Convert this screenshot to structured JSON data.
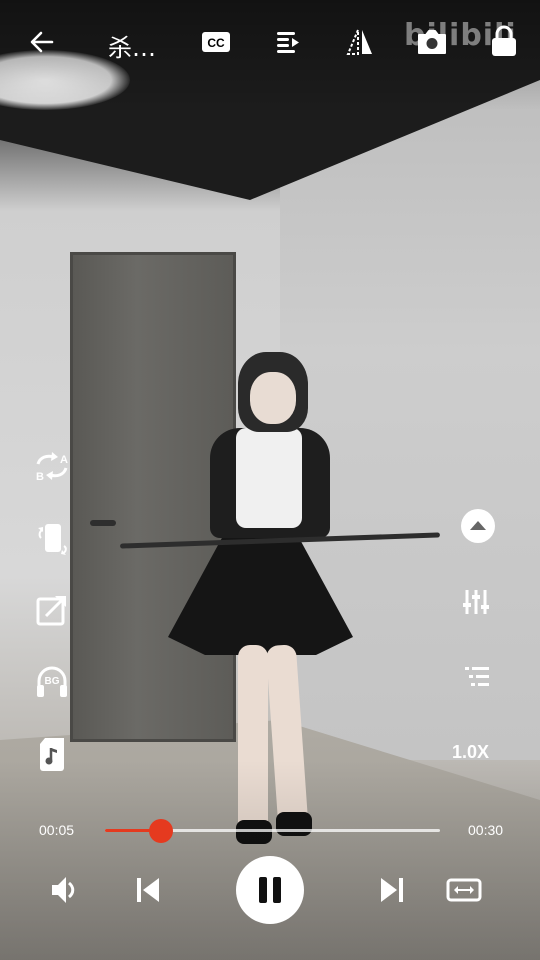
{
  "header": {
    "title": "杀…",
    "watermark": "bilibili"
  },
  "toolbar": {
    "icons": [
      "back-arrow-icon",
      "cc-icon",
      "playlist-icon",
      "mirror-icon",
      "camera-icon",
      "lock-icon"
    ]
  },
  "left_controls": {
    "ab_repeat": {
      "letters_a": "A",
      "letters_b": "B"
    },
    "background_play": {
      "badge": "BG"
    }
  },
  "right_controls": {
    "speed": "1.0X"
  },
  "progress": {
    "current": "00:05",
    "total": "00:30",
    "fraction": 0.1667
  },
  "colors": {
    "accent": "#e53a1f",
    "icon": "#ffffff"
  }
}
